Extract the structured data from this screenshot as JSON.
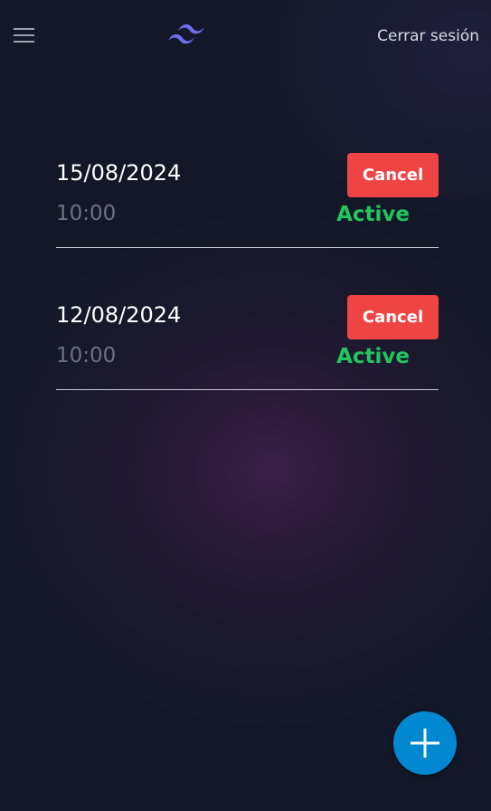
{
  "header": {
    "menu_icon": "hamburger-menu-icon",
    "logo_icon": "wave-logo-icon",
    "logout_label": "Cerrar sesión"
  },
  "appointments": [
    {
      "date": "15/08/2024",
      "time": "10:00",
      "cancel_label": "Cancel",
      "status": "Active"
    },
    {
      "date": "12/08/2024",
      "time": "10:00",
      "cancel_label": "Cancel",
      "status": "Active"
    }
  ],
  "fab": {
    "icon": "plus-icon"
  },
  "colors": {
    "background": "#121827",
    "cancel_button": "#ef4444",
    "status_active": "#22c55e",
    "time_text": "#6b7280",
    "fab": "#0288d1",
    "logo": "#6b6ff0"
  }
}
